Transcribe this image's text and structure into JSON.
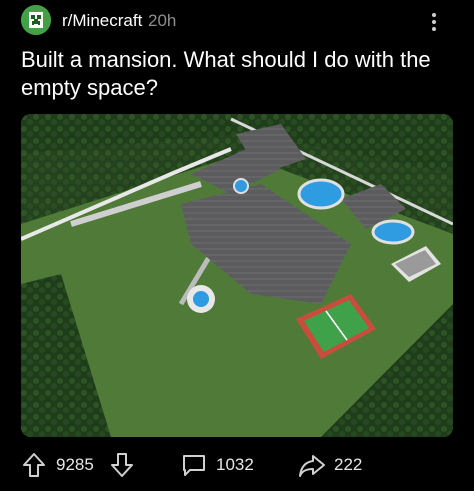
{
  "post": {
    "subreddit": "r/Minecraft",
    "age": "20h",
    "title": "Built a mansion. What should I do with the empty space?",
    "image_alt": "Aerial view of a Minecraft mansion with pools, tennis court and basketball court"
  },
  "actions": {
    "upvotes": "9285",
    "comments": "1032",
    "shares": "222"
  },
  "icons": {
    "avatar": "creeper-icon",
    "more": "kebab-menu-icon",
    "upvote": "upvote-arrow-icon",
    "downvote": "downvote-arrow-icon",
    "comment": "comment-bubble-icon",
    "share": "share-arrow-icon"
  },
  "colors": {
    "background": "#000000",
    "text": "#ffffff",
    "muted": "#8e8e93",
    "avatar_bg": "#43a046"
  }
}
